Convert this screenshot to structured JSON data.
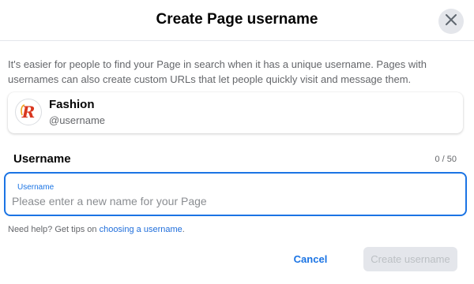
{
  "dialog": {
    "title": "Create Page username",
    "close_icon": "close-icon",
    "description": "It's easier for people to find your Page in search when it has a unique username. Pages with usernames can also create custom URLs that let people quickly visit and message them."
  },
  "page_card": {
    "name": "Fashion",
    "handle": "@username",
    "avatar_letter": "R",
    "avatar_icon": "page-logo-icon"
  },
  "username_field": {
    "section_label": "Username",
    "counter": "0 / 50",
    "floating_label": "Username",
    "value": "",
    "placeholder": "Please enter a new name for your Page"
  },
  "help": {
    "prefix": "Need help? Get tips on ",
    "link": "choosing a username",
    "suffix": "."
  },
  "actions": {
    "cancel_label": "Cancel",
    "create_label": "Create username"
  },
  "colors": {
    "accent": "#1b74e4",
    "disabled_bg": "#e4e6eb",
    "disabled_text": "#bcc0c4",
    "logo_red": "#d9361e",
    "logo_orange": "#f0a21a"
  }
}
